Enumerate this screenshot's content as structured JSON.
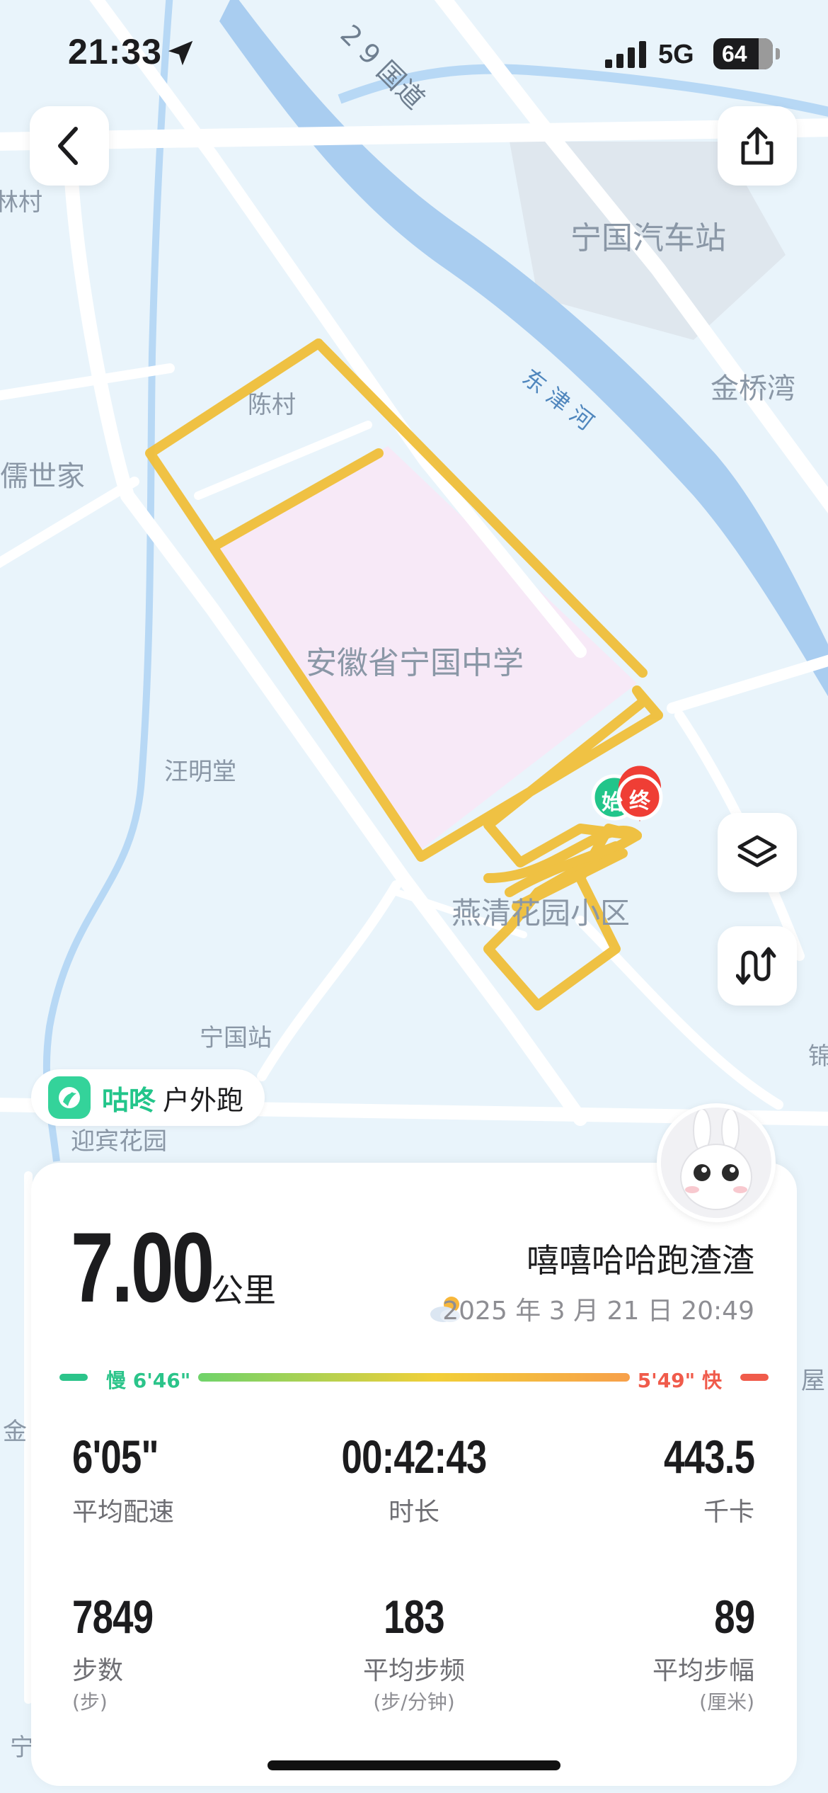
{
  "status_bar": {
    "time": "21:33",
    "network": "5G",
    "battery": "64"
  },
  "map": {
    "labels": {
      "highway": "2 9 国道",
      "bus_station": "宁国汽车站",
      "river": "东 津 河",
      "jinqiaowan": "金桥湾",
      "chencun": "陈村",
      "school": "安徽省宁国中学",
      "wangmingtang": "汪明堂",
      "yanqing": "燕清花园小区",
      "ningguo_station": "宁国站",
      "yingbin": "迎宾花园",
      "left_cun": "林村",
      "left_shijia": "儒世家",
      "right_jin": "锦",
      "right_wu": "屋",
      "left_jin": "金",
      "left_ning": "宁"
    },
    "start_marker": "始",
    "end_marker": "终",
    "route_color": "#f0bf3a"
  },
  "brand": {
    "name": "咕咚",
    "activity_type": "户外跑"
  },
  "summary": {
    "distance": "7.00",
    "distance_unit": "公里",
    "username": "嘻嘻哈哈跑渣渣",
    "datetime": "2025 年 3 月 21 日 20:49",
    "pace_slow_label": "慢 6'46\"",
    "pace_fast_label": "5'49\" 快"
  },
  "stats": [
    {
      "value": "6'05\"",
      "label": "平均配速",
      "sub": ""
    },
    {
      "value": "00:42:43",
      "label": "时长",
      "sub": ""
    },
    {
      "value": "443.5",
      "label": "千卡",
      "sub": ""
    },
    {
      "value": "7849",
      "label": "步数",
      "sub": "(步)"
    },
    {
      "value": "183",
      "label": "平均步频",
      "sub": "(步/分钟)"
    },
    {
      "value": "89",
      "label": "平均步幅",
      "sub": "(厘米)"
    }
  ],
  "colors": {
    "accent_green": "#22c58a",
    "pace_slow": "#2bc48a",
    "pace_fast": "#f05b4b",
    "map_bg": "#e9f4fb",
    "river": "#a9cdf0"
  },
  "icons": [
    "back-icon",
    "share-icon",
    "layers-icon",
    "route-toggle-icon",
    "location-arrow-icon",
    "weather-icon",
    "gudong-logo-icon"
  ]
}
